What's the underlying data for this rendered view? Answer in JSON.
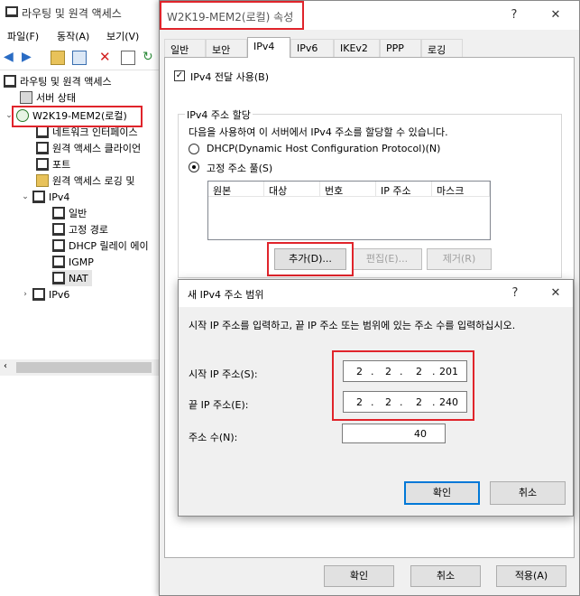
{
  "background": {
    "title": "라우팅 및 원격 액세스",
    "menu": [
      "파일(F)",
      "동작(A)",
      "보기(V)"
    ],
    "tree": {
      "root": "라우팅 및 원격 액세스",
      "server_status": "서버 상태",
      "server": "W2K19-MEM2(로컬)",
      "network_interfaces": "네트워크 인터페이스",
      "remote_clients": "원격 액세스 클라이언",
      "ports": "포트",
      "logging": "원격 액세스 로깅 및",
      "ipv4": "IPv4",
      "general": "일반",
      "static_routes": "고정 경로",
      "dhcp_relay": "DHCP 릴레이 에이",
      "igmp": "IGMP",
      "nat": "NAT",
      "ipv6": "IPv6"
    }
  },
  "props": {
    "title": "W2K19-MEM2(로컬) 속성",
    "help": "?",
    "close": "✕",
    "tabs": [
      "일반",
      "보안",
      "IPv4",
      "IPv6",
      "IKEv2",
      "PPP",
      "로깅"
    ],
    "forwarding_label": "IPv4 전달 사용(B)",
    "forwarding_check": "✓",
    "group_label": "IPv4 주소 할당",
    "group_desc": "다음을 사용하여 이 서버에서 IPv4 주소를 할당할 수 있습니다.",
    "dhcp_label": "DHCP(Dynamic Host Configuration Protocol)(N)",
    "static_label": "고정 주소 풀(S)",
    "columns": [
      "원본",
      "대상",
      "번호",
      "IP 주소",
      "마스크"
    ],
    "add_button": "추가(D)...",
    "edit_button": "편집(E)...",
    "remove_button": "제거(R)",
    "ok_button": "확인",
    "cancel_button": "취소",
    "apply_button": "적용(A)"
  },
  "range_dialog": {
    "title": "새 IPv4 주소 범위",
    "help": "?",
    "close": "✕",
    "instruction": "시작 IP 주소를 입력하고, 끝 IP 주소 또는 범위에 있는 주소 수를 입력하십시오.",
    "start_label": "시작 IP 주소(S):",
    "start_octets": [
      "2",
      "2",
      "2",
      "201"
    ],
    "end_label": "끝 IP 주소(E):",
    "end_octets": [
      "2",
      "2",
      "2",
      "240"
    ],
    "count_label": "주소 수(N):",
    "count_value": "40",
    "ok_button": "확인",
    "cancel_button": "취소",
    "dot": "."
  },
  "colors": {
    "highlight": "#e0242b",
    "focus": "#0078d7"
  }
}
